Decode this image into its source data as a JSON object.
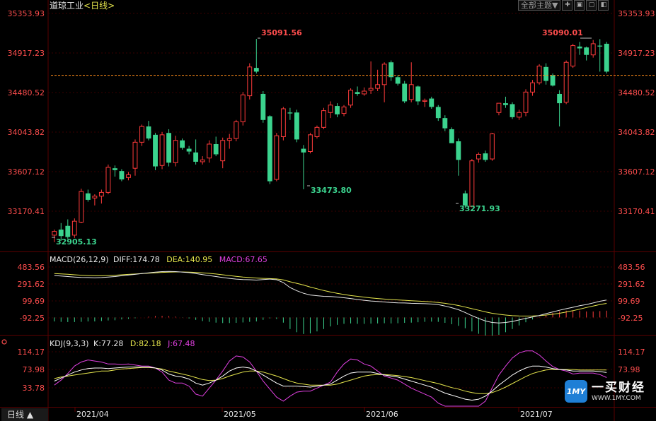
{
  "header": {
    "title": "道琼工业",
    "period_tag": "<日线>"
  },
  "toolbar": {
    "theme_label": "全部主题▼",
    "icons": [
      "crosshair-icon",
      "zoom-in-icon",
      "zoom-out-icon",
      "prev-icon"
    ]
  },
  "colors": {
    "up": "#ff3b3b",
    "down": "#3bd38e",
    "grid": "#3a0000",
    "price_axis": "#ff4d4d",
    "diff": "#e8e8e8",
    "dea": "#e6e64d",
    "macd": "#e040e0",
    "k": "#ffffff",
    "d": "#e6e64d",
    "j": "#e040e0",
    "last": "#ff8c1a"
  },
  "price_axis": {
    "ticks": [
      "35353.93",
      "34917.23",
      "34480.52",
      "34043.82",
      "33607.12",
      "33170.41"
    ]
  },
  "annotations": {
    "high1": "35091.56",
    "low1": "32905.13",
    "low2": "33473.80",
    "low3": "33271.93",
    "high2": "35090.01"
  },
  "macd": {
    "label": "MACD(26,12,9)",
    "diff_label": "DIFF:174.78",
    "dea_label": "DEA:140.95",
    "macd_label": "MACD:67.65",
    "ticks": [
      "483.56",
      "291.62",
      "99.69",
      "-92.25"
    ]
  },
  "kdj": {
    "label": "KDJ(9,3,3)",
    "k_label": "K:77.28",
    "d_label": "D:82.18",
    "j_label": "J:67.48",
    "ticks": [
      "114.17",
      "73.98",
      "33.78"
    ]
  },
  "xaxis": {
    "labels": [
      "2021/04",
      "2021/05",
      "2021/06",
      "2021/07"
    ]
  },
  "footer": {
    "period_label": "日线 ▲"
  },
  "logo": {
    "badge": "1MY",
    "name": "一买财经",
    "url": "WWW.1MY.COM"
  },
  "chart_data": {
    "type": "candlestick",
    "title": "道琼工业 日线",
    "ylim": [
      32850,
      35450
    ],
    "last_price": 34700,
    "candles": [
      {
        "o": 32980,
        "h": 33040,
        "l": 32905,
        "c": 33020
      },
      {
        "o": 33040,
        "h": 33110,
        "l": 32920,
        "c": 32970
      },
      {
        "o": 33080,
        "h": 33150,
        "l": 32940,
        "c": 32960
      },
      {
        "o": 32980,
        "h": 33160,
        "l": 32950,
        "c": 33130
      },
      {
        "o": 33120,
        "h": 33480,
        "l": 33110,
        "c": 33450
      },
      {
        "o": 33430,
        "h": 33470,
        "l": 33340,
        "c": 33360
      },
      {
        "o": 33380,
        "h": 33420,
        "l": 33300,
        "c": 33400
      },
      {
        "o": 33400,
        "h": 33470,
        "l": 33320,
        "c": 33440
      },
      {
        "o": 33440,
        "h": 33740,
        "l": 33420,
        "c": 33710
      },
      {
        "o": 33700,
        "h": 33730,
        "l": 33610,
        "c": 33680
      },
      {
        "o": 33670,
        "h": 33690,
        "l": 33560,
        "c": 33580
      },
      {
        "o": 33600,
        "h": 33660,
        "l": 33570,
        "c": 33630
      },
      {
        "o": 33700,
        "h": 34010,
        "l": 33620,
        "c": 33980
      },
      {
        "o": 33980,
        "h": 34170,
        "l": 33940,
        "c": 34150
      },
      {
        "o": 34150,
        "h": 34210,
        "l": 34000,
        "c": 34020
      },
      {
        "o": 34060,
        "h": 34080,
        "l": 33680,
        "c": 33720
      },
      {
        "o": 33730,
        "h": 34090,
        "l": 33690,
        "c": 34060
      },
      {
        "o": 34080,
        "h": 34120,
        "l": 33720,
        "c": 33760
      },
      {
        "o": 33760,
        "h": 34050,
        "l": 33720,
        "c": 34000
      },
      {
        "o": 34000,
        "h": 34020,
        "l": 33900,
        "c": 33920
      },
      {
        "o": 33910,
        "h": 33940,
        "l": 33850,
        "c": 33880
      },
      {
        "o": 33870,
        "h": 34010,
        "l": 33740,
        "c": 33770
      },
      {
        "o": 33770,
        "h": 33830,
        "l": 33740,
        "c": 33790
      },
      {
        "o": 33810,
        "h": 34000,
        "l": 33760,
        "c": 33960
      },
      {
        "o": 33960,
        "h": 34040,
        "l": 33830,
        "c": 33850
      },
      {
        "o": 33780,
        "h": 34030,
        "l": 33700,
        "c": 34000
      },
      {
        "o": 34000,
        "h": 34070,
        "l": 33910,
        "c": 34020
      },
      {
        "o": 34020,
        "h": 34220,
        "l": 33990,
        "c": 34200
      },
      {
        "o": 34200,
        "h": 34520,
        "l": 34160,
        "c": 34490
      },
      {
        "o": 34480,
        "h": 34830,
        "l": 34440,
        "c": 34790
      },
      {
        "o": 34780,
        "h": 35092,
        "l": 34720,
        "c": 34740
      },
      {
        "o": 34500,
        "h": 34530,
        "l": 34190,
        "c": 34220
      },
      {
        "o": 34260,
        "h": 34270,
        "l": 33530,
        "c": 33560
      },
      {
        "o": 33580,
        "h": 34080,
        "l": 33560,
        "c": 34050
      },
      {
        "o": 34040,
        "h": 34360,
        "l": 34000,
        "c": 34340
      },
      {
        "o": 34300,
        "h": 34350,
        "l": 34220,
        "c": 34290
      },
      {
        "o": 34300,
        "h": 34330,
        "l": 33980,
        "c": 34010
      },
      {
        "o": 33910,
        "h": 33950,
        "l": 33474,
        "c": 33870
      },
      {
        "o": 33880,
        "h": 34080,
        "l": 33860,
        "c": 34060
      },
      {
        "o": 34040,
        "h": 34160,
        "l": 34020,
        "c": 34140
      },
      {
        "o": 34140,
        "h": 34350,
        "l": 34120,
        "c": 34320
      },
      {
        "o": 34300,
        "h": 34420,
        "l": 34240,
        "c": 34380
      },
      {
        "o": 34370,
        "h": 34400,
        "l": 34250,
        "c": 34280
      },
      {
        "o": 34290,
        "h": 34380,
        "l": 34260,
        "c": 34360
      },
      {
        "o": 34380,
        "h": 34560,
        "l": 34350,
        "c": 34540
      },
      {
        "o": 34520,
        "h": 34580,
        "l": 34480,
        "c": 34500
      },
      {
        "o": 34500,
        "h": 34570,
        "l": 34480,
        "c": 34530
      },
      {
        "o": 34540,
        "h": 34850,
        "l": 34500,
        "c": 34560
      },
      {
        "o": 34560,
        "h": 34760,
        "l": 34530,
        "c": 34600
      },
      {
        "o": 34600,
        "h": 34840,
        "l": 34410,
        "c": 34820
      },
      {
        "o": 34840,
        "h": 34860,
        "l": 34640,
        "c": 34680
      },
      {
        "o": 34680,
        "h": 34700,
        "l": 34590,
        "c": 34610
      },
      {
        "o": 34610,
        "h": 34640,
        "l": 34400,
        "c": 34420
      },
      {
        "o": 34440,
        "h": 34840,
        "l": 34410,
        "c": 34600
      },
      {
        "o": 34580,
        "h": 34590,
        "l": 34380,
        "c": 34420
      },
      {
        "o": 34420,
        "h": 34450,
        "l": 34360,
        "c": 34430
      },
      {
        "o": 34450,
        "h": 34470,
        "l": 34340,
        "c": 34360
      },
      {
        "o": 34360,
        "h": 34380,
        "l": 34210,
        "c": 34240
      },
      {
        "o": 34240,
        "h": 34270,
        "l": 34100,
        "c": 34130
      },
      {
        "o": 34120,
        "h": 34140,
        "l": 33980,
        "c": 33970
      },
      {
        "o": 33990,
        "h": 34020,
        "l": 33620,
        "c": 33790
      },
      {
        "o": 33430,
        "h": 33460,
        "l": 33272,
        "c": 33300
      },
      {
        "o": 33290,
        "h": 33800,
        "l": 33280,
        "c": 33780
      },
      {
        "o": 33800,
        "h": 33870,
        "l": 33760,
        "c": 33850
      },
      {
        "o": 33860,
        "h": 33890,
        "l": 33770,
        "c": 33790
      },
      {
        "o": 33800,
        "h": 34080,
        "l": 33780,
        "c": 34070
      },
      {
        "o": 34300,
        "h": 34400,
        "l": 34270,
        "c": 34400
      },
      {
        "o": 34400,
        "h": 34470,
        "l": 34350,
        "c": 34380
      },
      {
        "o": 34390,
        "h": 34410,
        "l": 34230,
        "c": 34250
      },
      {
        "o": 34250,
        "h": 34330,
        "l": 34220,
        "c": 34300
      },
      {
        "o": 34300,
        "h": 34550,
        "l": 34260,
        "c": 34520
      },
      {
        "o": 34520,
        "h": 34650,
        "l": 34480,
        "c": 34620
      },
      {
        "o": 34620,
        "h": 34820,
        "l": 34600,
        "c": 34800
      },
      {
        "o": 34790,
        "h": 34830,
        "l": 34600,
        "c": 34640
      },
      {
        "o": 34700,
        "h": 34720,
        "l": 34580,
        "c": 34590
      },
      {
        "o": 34500,
        "h": 34540,
        "l": 34150,
        "c": 34400
      },
      {
        "o": 34410,
        "h": 34860,
        "l": 34390,
        "c": 34840
      },
      {
        "o": 34800,
        "h": 35040,
        "l": 34780,
        "c": 35020
      },
      {
        "o": 35010,
        "h": 35060,
        "l": 34920,
        "c": 34990
      },
      {
        "o": 35000,
        "h": 35010,
        "l": 34860,
        "c": 34920
      },
      {
        "o": 34920,
        "h": 35080,
        "l": 34890,
        "c": 35040
      },
      {
        "o": 35020,
        "h": 35090,
        "l": 34740,
        "c": 35010
      },
      {
        "o": 35040,
        "h": 35060,
        "l": 34720,
        "c": 34740
      }
    ],
    "macd_ylim": [
      -160,
      520
    ],
    "diff": [
      420,
      415,
      410,
      405,
      402,
      400,
      398,
      400,
      405,
      410,
      418,
      425,
      432,
      440,
      448,
      455,
      460,
      462,
      460,
      455,
      450,
      440,
      430,
      420,
      410,
      400,
      392,
      385,
      380,
      378,
      375,
      380,
      385,
      378,
      350,
      300,
      268,
      242,
      225,
      218,
      212,
      210,
      205,
      198,
      190,
      180,
      172,
      165,
      160,
      155,
      150,
      147,
      145,
      142,
      140,
      138,
      135,
      128,
      115,
      98,
      78,
      50,
      18,
      -10,
      -35,
      -50,
      -55,
      -50,
      -40,
      -25,
      -10,
      5,
      20,
      38,
      55,
      72,
      88,
      102,
      118,
      130,
      145,
      162,
      175
    ],
    "dea": [
      440,
      437,
      433,
      428,
      424,
      420,
      418,
      418,
      420,
      424,
      428,
      432,
      436,
      440,
      444,
      448,
      452,
      455,
      456,
      456,
      455,
      452,
      448,
      442,
      436,
      428,
      420,
      412,
      405,
      400,
      395,
      392,
      390,
      386,
      376,
      358,
      342,
      325,
      305,
      288,
      270,
      255,
      242,
      230,
      220,
      212,
      204,
      196,
      190,
      184,
      180,
      176,
      172,
      168,
      164,
      160,
      156,
      150,
      142,
      132,
      120,
      104,
      88,
      72,
      56,
      42,
      32,
      24,
      18,
      15,
      14,
      15,
      18,
      24,
      32,
      42,
      54,
      68,
      84,
      100,
      115,
      130,
      141
    ],
    "kdj_ylim": [
      10,
      124
    ],
    "k": [
      60,
      66,
      72,
      78,
      82,
      85,
      86,
      86,
      85,
      86,
      87,
      88,
      88,
      88,
      88,
      86,
      82,
      74,
      70,
      68,
      64,
      56,
      52,
      56,
      62,
      70,
      80,
      86,
      88,
      86,
      80,
      72,
      64,
      56,
      50,
      50,
      50,
      49,
      48,
      50,
      52,
      54,
      62,
      70,
      76,
      78,
      78,
      78,
      75,
      72,
      70,
      68,
      64,
      60,
      56,
      52,
      48,
      42,
      36,
      32,
      28,
      24,
      22,
      24,
      30,
      40,
      52,
      62,
      72,
      80,
      86,
      90,
      90,
      88,
      85,
      83,
      82,
      80,
      80,
      80,
      80,
      79,
      77
    ],
    "d": [
      65,
      68,
      70,
      72,
      74,
      76,
      78,
      80,
      80,
      82,
      84,
      85,
      86,
      87,
      87,
      86,
      84,
      80,
      77,
      74,
      71,
      67,
      63,
      61,
      62,
      65,
      70,
      74,
      78,
      80,
      80,
      78,
      74,
      70,
      65,
      60,
      56,
      54,
      52,
      52,
      52,
      52,
      54,
      58,
      62,
      66,
      70,
      72,
      73,
      73,
      72,
      71,
      69,
      67,
      64,
      61,
      58,
      55,
      51,
      47,
      44,
      40,
      37,
      35,
      35,
      37,
      42,
      48,
      55,
      62,
      69,
      75,
      79,
      82,
      83,
      83,
      83,
      83,
      82,
      82,
      82,
      82,
      82
    ],
    "j": [
      52,
      62,
      75,
      90,
      98,
      102,
      100,
      98,
      94,
      94,
      93,
      94,
      92,
      90,
      90,
      86,
      78,
      62,
      56,
      56,
      50,
      34,
      30,
      46,
      62,
      80,
      100,
      110,
      108,
      98,
      80,
      60,
      44,
      28,
      20,
      30,
      38,
      40,
      40,
      46,
      52,
      58,
      78,
      94,
      104,
      102,
      94,
      90,
      80,
      70,
      66,
      62,
      54,
      46,
      40,
      34,
      28,
      16,
      6,
      2,
      -4,
      -8,
      -8,
      2,
      20,
      46,
      72,
      90,
      106,
      116,
      120,
      120,
      112,
      100,
      89,
      83,
      80,
      74,
      76,
      76,
      76,
      73,
      67
    ]
  }
}
